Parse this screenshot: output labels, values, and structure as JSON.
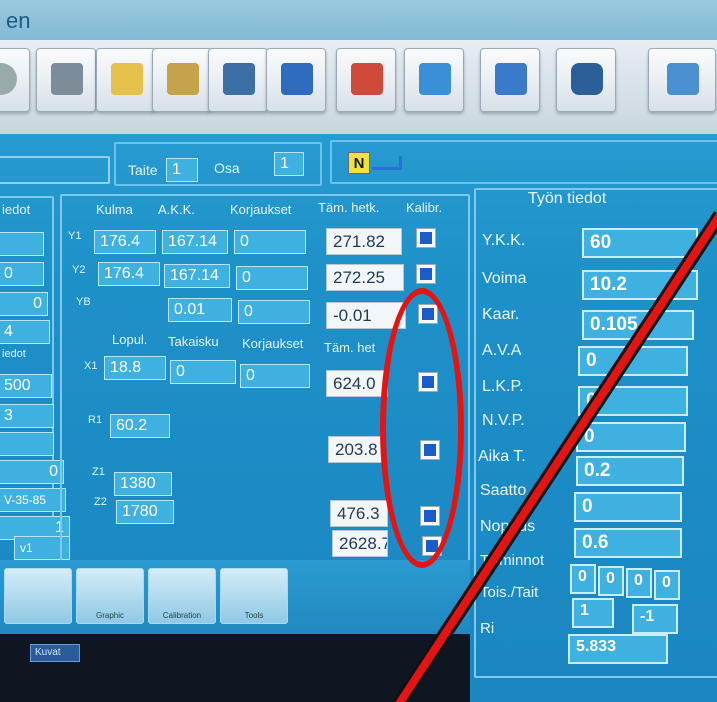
{
  "window": {
    "title_fragment": "en"
  },
  "toolbar": {
    "buttons": [
      {
        "icon": "gear-icon"
      },
      {
        "icon": "joystick-icon"
      },
      {
        "icon": "document-copy-icon"
      },
      {
        "icon": "download-document-icon"
      },
      {
        "icon": "tools-icon"
      },
      {
        "icon": "save-disk-icon"
      },
      {
        "icon": "arrow-left-icon"
      },
      {
        "icon": "arrow-right-icon"
      },
      {
        "icon": "folder-icon"
      },
      {
        "icon": "bottle-icon"
      },
      {
        "icon": "help-book-icon"
      }
    ]
  },
  "top_row": {
    "taite_label": "Taite",
    "taite_value": "1",
    "osa_label": "Osa",
    "osa_value": "1",
    "mode_badge": "N"
  },
  "left_panel": {
    "header_fragment": "iedot",
    "subheader_fragment": "iedot",
    "values": [
      "0",
      "0",
      "4",
      "500",
      "3",
      "0",
      "V-35-85",
      "1",
      "v1"
    ]
  },
  "middle": {
    "headers1": {
      "kulma": "Kulma",
      "akk": "A.K.K.",
      "korjaukset": "Korjaukset",
      "tam": "Täm. hetk.",
      "kalibr": "Kalibr."
    },
    "rows1": [
      {
        "label": "Y1",
        "kulma": "176.4",
        "akk": "167.14",
        "korj": "0",
        "tam": "271.82"
      },
      {
        "label": "Y2",
        "kulma": "176.4",
        "akk": "167.14",
        "korj": "0",
        "tam": "272.25"
      },
      {
        "label": "YB",
        "akk": "0.01",
        "korj": "0",
        "tam": "-0.01"
      }
    ],
    "headers2": {
      "lopul": "Lopul.",
      "takaisku": "Takaisku",
      "korjaukset": "Korjaukset",
      "tam": "Täm. het"
    },
    "x1": {
      "label": "X1",
      "lopul": "18.8",
      "takaisku": "0",
      "korj": "0",
      "tam": "624.0"
    },
    "r1": {
      "label": "R1",
      "value": "60.2",
      "tam": "203.8"
    },
    "z1": {
      "label": "Z1",
      "value": "1380"
    },
    "z2": {
      "label": "Z2",
      "value": "1780",
      "tam": "476.3"
    },
    "extra_tam": "2628.7"
  },
  "right_panel": {
    "title": "Työn tiedot",
    "items": [
      {
        "label": "Y.K.K.",
        "value": "60"
      },
      {
        "label": "Voima",
        "value": "10.2"
      },
      {
        "label": "Kaar.",
        "value": "0.105"
      },
      {
        "label": "A.V.A",
        "value": "0"
      },
      {
        "label": "L.K.P.",
        "value": "0"
      },
      {
        "label": "N.V.P.",
        "value": "0"
      },
      {
        "label": "Aika T.",
        "value": "0.2"
      },
      {
        "label": "Saatto",
        "value": "0"
      },
      {
        "label": "Nopeus",
        "value": "0.6"
      }
    ],
    "toiminnot_label": "Toiminnot",
    "toiminnot_values": [
      "0",
      "0",
      "0",
      "0"
    ],
    "tois_label": "Tois./Tait",
    "tois_values": [
      "1",
      "-1"
    ],
    "ri_label": "Ri",
    "ri_value": "5.833"
  },
  "bottom_bar": {
    "buttons": [
      {
        "label": ""
      },
      {
        "label": "Graphic"
      },
      {
        "label": "Calibration"
      },
      {
        "label": "Tools"
      }
    ],
    "taskbar_item": "Kuvat"
  },
  "colors": {
    "panel_bg": "#1e90c8",
    "value_bg": "#3fb1e0",
    "checkbox_blue": "#1b5cc8",
    "annotation_red": "#e31414"
  }
}
